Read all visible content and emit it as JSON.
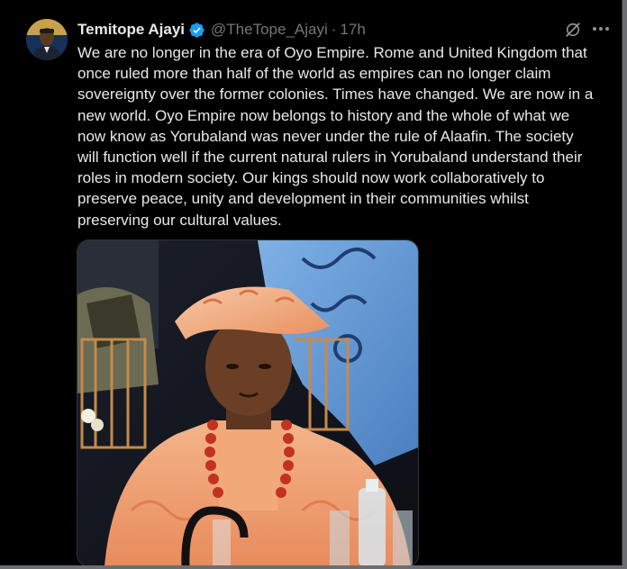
{
  "tweet": {
    "author_name": "Temitope Ajayi",
    "handle": "@TheTope_Ajayi",
    "separator": "·",
    "time": "17h",
    "verified": true,
    "text_lines": [
      "We are no longer in the era of Oyo Empire. Rome and United Kingdom that",
      "once ruled more than half of the world as empires can no longer claim",
      "sovereignty over the former colonies. Times have changed. We are now in a",
      "new world. Oyo Empire now belongs to history and the whole of what we",
      "now know as Yorubaland was never under the rule of Alaafin. The society",
      "will function well if the current natural rulers in Yorubaland understand their",
      "roles in modern society. Our kings should now work collaboratively to",
      "preserve peace, unity and development in their communities whilst",
      "preserving our cultural values."
    ]
  },
  "icons": {
    "verified": "verified-badge-icon",
    "grok": "grok-icon",
    "more": "more-icon"
  },
  "colors": {
    "background": "#000000",
    "text_primary": "#e7e9ea",
    "text_secondary": "#71767b",
    "verified_blue": "#1d9bf0",
    "border": "#2f3336"
  }
}
